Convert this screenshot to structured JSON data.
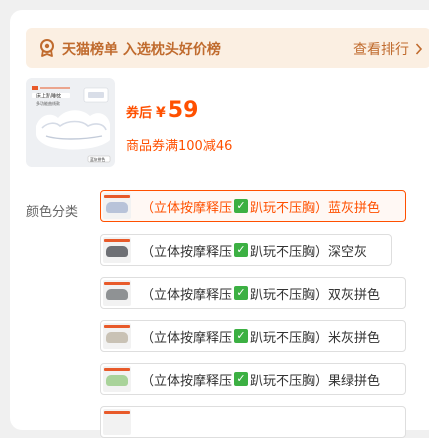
{
  "banner": {
    "title": "天猫榜单 入选枕头好价榜",
    "more_label": "查看排行",
    "icon": "medal-icon"
  },
  "product": {
    "image_texts": [
      "床上趴睡枕",
      "多功能曲线款",
      "蓝灰拼色"
    ],
    "price_prefix": "券后",
    "currency": "¥",
    "price": "59",
    "coupon_text": "商品券满100减46"
  },
  "color_section": {
    "label": "颜色分类",
    "selected_index": 0,
    "options": [
      {
        "prefix": "（立体按摩释压",
        "check": "✓",
        "suffix": "趴玩不压胸）蓝灰拼色",
        "swatch": "#b8c3d9"
      },
      {
        "prefix": "（立体按摩释压",
        "check": "✓",
        "suffix": "趴玩不压胸）深空灰",
        "swatch": "#6e7075"
      },
      {
        "prefix": "（立体按摩释压",
        "check": "✓",
        "suffix": "趴玩不压胸）双灰拼色",
        "swatch": "#8f9294"
      },
      {
        "prefix": "（立体按摩释压",
        "check": "✓",
        "suffix": "趴玩不压胸）米灰拼色",
        "swatch": "#c9c2b5"
      },
      {
        "prefix": "（立体按摩释压",
        "check": "✓",
        "suffix": "趴玩不压胸）果绿拼色",
        "swatch": "#a9d39a"
      }
    ]
  },
  "colors": {
    "accent": "#ff5000",
    "banner_bg": "#fbefe2",
    "banner_text": "#c06b2e",
    "check_green": "#3cb043"
  }
}
